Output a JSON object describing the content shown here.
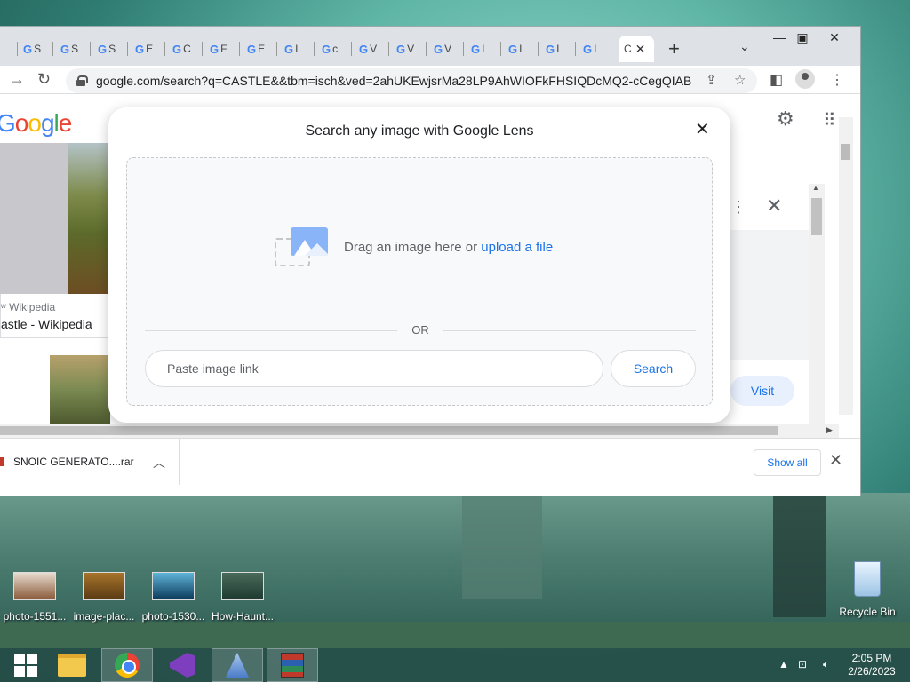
{
  "browser": {
    "tabs": [
      {
        "label": "S"
      },
      {
        "label": "S"
      },
      {
        "label": "S"
      },
      {
        "label": "E"
      },
      {
        "label": "C"
      },
      {
        "label": "F"
      },
      {
        "label": "E"
      },
      {
        "label": "I"
      },
      {
        "label": "c"
      },
      {
        "label": "V"
      },
      {
        "label": "V"
      },
      {
        "label": "V"
      },
      {
        "label": "I"
      },
      {
        "label": "I"
      },
      {
        "label": "I"
      }
    ],
    "active_tab_label": "C",
    "url": "google.com/search?q=CASTLE&&tbm=isch&ved=2ahUKEwjsrMa28LP9AhWIOFkFHSIQDcMQ2-cCegQIABA..."
  },
  "page": {
    "result_source": "Wikipedia",
    "result_title": "astle - Wikipedia",
    "visit_label": "Visit"
  },
  "lens": {
    "title": "Search any image with Google Lens",
    "drag_text": "Drag an image here or",
    "upload_link": "upload a file",
    "or_label": "OR",
    "paste_placeholder": "Paste image link",
    "search_label": "Search"
  },
  "downloads": {
    "filename": "SNOIC GENERATO....rar",
    "show_all_label": "Show all"
  },
  "desktop": {
    "icons": [
      {
        "label": "photo-1551..."
      },
      {
        "label": "image-plac..."
      },
      {
        "label": "photo-1530..."
      },
      {
        "label": "How-Haunt..."
      }
    ],
    "recycle_label": "Recycle Bin"
  },
  "taskbar": {
    "time": "2:05 PM",
    "date": "2/26/2023"
  }
}
